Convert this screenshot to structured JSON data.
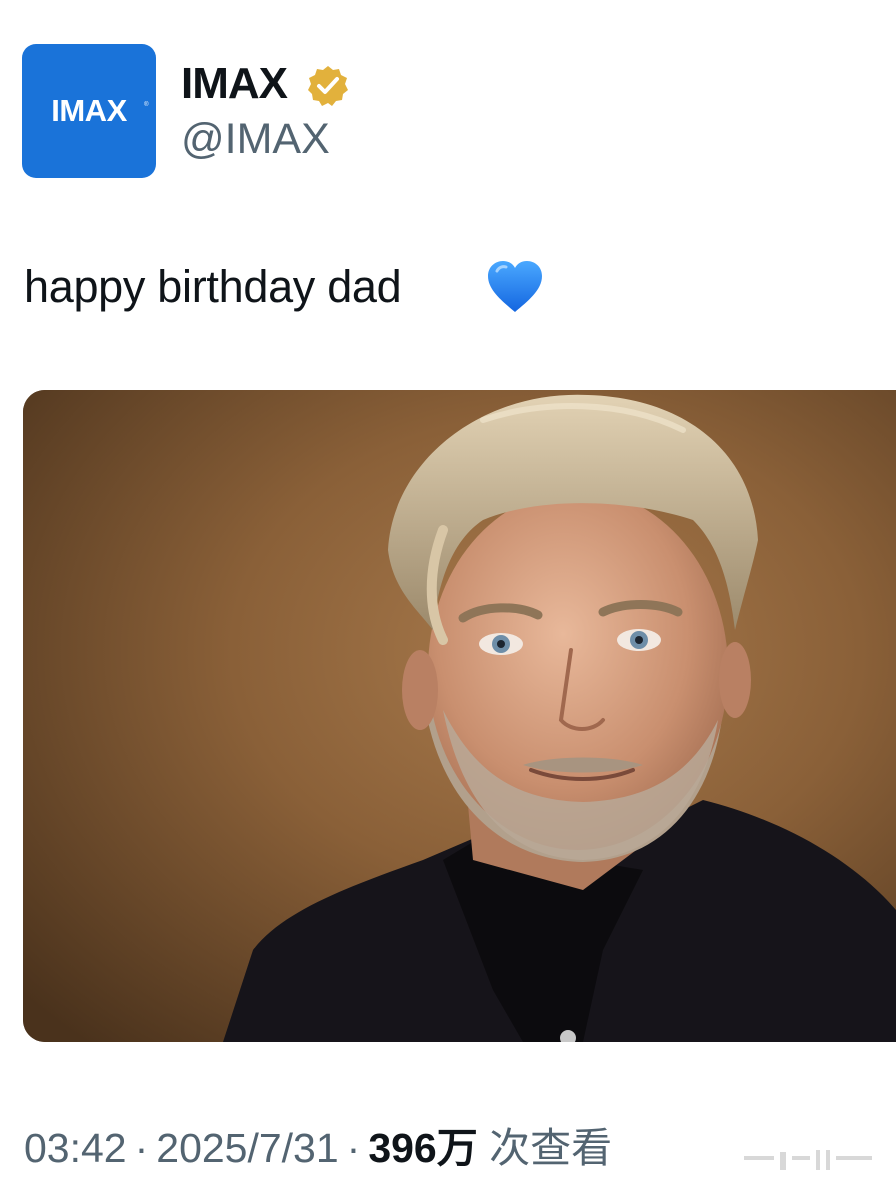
{
  "account": {
    "avatar_logo_text": "IMAX",
    "display_name": "IMAX",
    "handle": "@IMAX",
    "verified": true,
    "verified_badge_color": "#e2b13c",
    "avatar_color": "#1a73d9"
  },
  "tweet": {
    "text": "happy birthday dad",
    "emoji": "blue-heart-icon",
    "media": {
      "type": "photo",
      "background_color": "#8a6038"
    }
  },
  "meta": {
    "time": "03:42",
    "separator": "·",
    "date": "2025/7/31",
    "views_count": "396万",
    "views_label": "次查看"
  },
  "colors": {
    "text_primary": "#0f1419",
    "text_secondary": "#536471"
  }
}
